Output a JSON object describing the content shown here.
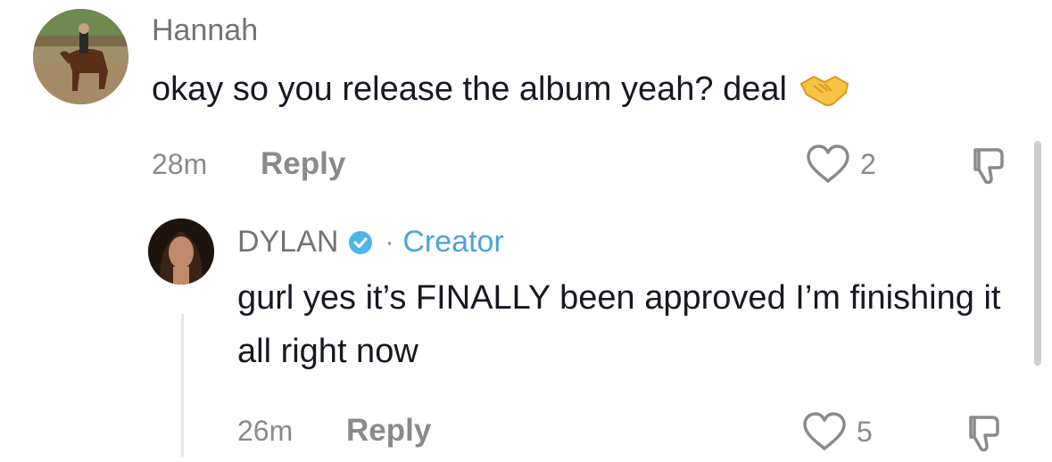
{
  "comments": [
    {
      "username": "Hannah",
      "text": "okay so you release the album yeah? deal",
      "emoji": "handshake-emoji",
      "time": "28m",
      "reply_label": "Reply",
      "like_count": "2"
    }
  ],
  "reply": {
    "username": "DYLAN",
    "separator": "·",
    "badge": "Creator",
    "text": "gurl yes it’s FINALLY been approved I’m finishing it all right now",
    "time": "26m",
    "reply_label": "Reply",
    "like_count": "5"
  },
  "colors": {
    "text": "#161823",
    "muted": "#8a8a8a",
    "creator_accent": "#4ea1d8",
    "verified_badge": "#4bb6e8"
  },
  "icons": [
    "avatar-hannah",
    "avatar-dylan",
    "verified-icon",
    "handshake-emoji",
    "heart-icon",
    "dislike-icon"
  ]
}
